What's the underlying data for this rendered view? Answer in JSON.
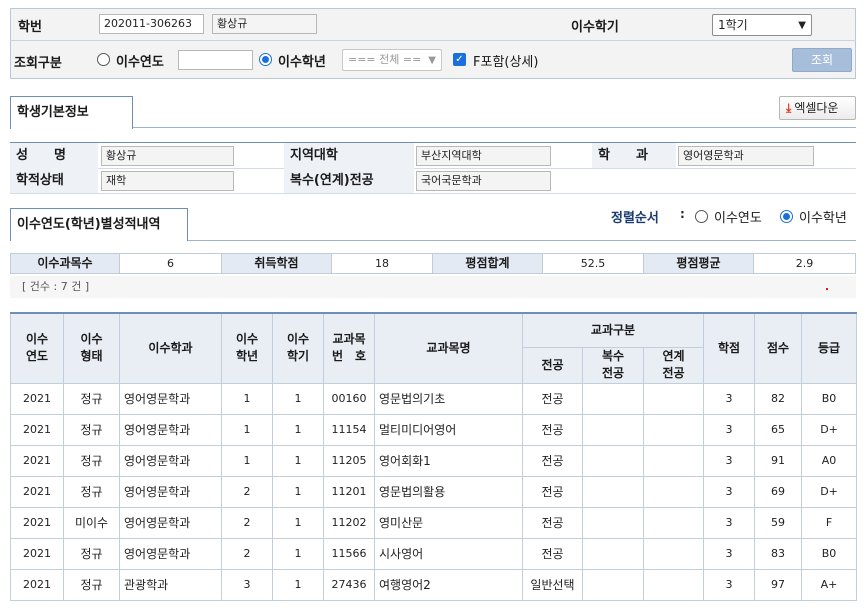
{
  "search": {
    "student_id_label": "학번",
    "student_id": "202011-306263",
    "student_name": "황상규",
    "semester_label": "이수학기",
    "semester_value": "1학기",
    "query_type_label": "조회구분",
    "opt_year_label": "이수연도",
    "opt_year_value": "",
    "opt_grade_label": "이수학년",
    "grade_select_value": "=== 전체 ==",
    "f_include_label": "F포함(상세)",
    "search_button": "조회"
  },
  "tabs": {
    "basic_info": "학생기본정보",
    "records": "이수연도(학년)별성적내역"
  },
  "excel_button": "엑셀다운",
  "info": {
    "name_label": "성　　명",
    "name": "황상규",
    "region_label": "지역대학",
    "region": "부산지역대학",
    "dept_label": "학　　과",
    "dept": "영어영문학과",
    "status_label": "학적상태",
    "status": "재학",
    "double_major_label": "복수(연계)전공",
    "double_major": "국어국문학과"
  },
  "sort": {
    "label": "정렬순서",
    "colon": ":",
    "opt_year": "이수연도",
    "opt_grade": "이수학년"
  },
  "summary": {
    "course_count_label": "이수과목수",
    "course_count": "6",
    "credits_label": "취득학점",
    "credits": "18",
    "grade_sum_label": "평점합계",
    "grade_sum": "52.5",
    "gpa_label": "평점평균",
    "gpa": "2.9"
  },
  "count_text": "[ 건수 : 7 건 ]",
  "table": {
    "headers": {
      "year": "이수\n연도",
      "type": "이수\n형태",
      "dept": "이수학과",
      "grade": "이수\n학년",
      "semester": "이수\n학기",
      "course_no": "교과목\n번　호",
      "course_name": "교과목명",
      "category": "교과구분",
      "major": "전공",
      "double": "복수\n전공",
      "linked": "연계\n전공",
      "credit": "학점",
      "score": "점수",
      "rank": "등급"
    },
    "rows": [
      {
        "year": "2021",
        "type": "정규",
        "dept": "영어영문학과",
        "grade": "1",
        "semester": "1",
        "no": "00160",
        "name": "영문법의기초",
        "major": "전공",
        "double": "",
        "linked": "",
        "credit": "3",
        "score": "82",
        "rank": "B0"
      },
      {
        "year": "2021",
        "type": "정규",
        "dept": "영어영문학과",
        "grade": "1",
        "semester": "1",
        "no": "11154",
        "name": "멀티미디어영어",
        "major": "전공",
        "double": "",
        "linked": "",
        "credit": "3",
        "score": "65",
        "rank": "D+"
      },
      {
        "year": "2021",
        "type": "정규",
        "dept": "영어영문학과",
        "grade": "1",
        "semester": "1",
        "no": "11205",
        "name": "영어회화1",
        "major": "전공",
        "double": "",
        "linked": "",
        "credit": "3",
        "score": "91",
        "rank": "A0"
      },
      {
        "year": "2021",
        "type": "정규",
        "dept": "영어영문학과",
        "grade": "2",
        "semester": "1",
        "no": "11201",
        "name": "영문법의활용",
        "major": "전공",
        "double": "",
        "linked": "",
        "credit": "3",
        "score": "69",
        "rank": "D+"
      },
      {
        "year": "2021",
        "type": "미이수",
        "dept": "영어영문학과",
        "grade": "2",
        "semester": "1",
        "no": "11202",
        "name": "영미산문",
        "major": "전공",
        "double": "",
        "linked": "",
        "credit": "3",
        "score": "59",
        "rank": "F"
      },
      {
        "year": "2021",
        "type": "정규",
        "dept": "영어영문학과",
        "grade": "2",
        "semester": "1",
        "no": "11566",
        "name": "시사영어",
        "major": "전공",
        "double": "",
        "linked": "",
        "credit": "3",
        "score": "83",
        "rank": "B0"
      },
      {
        "year": "2021",
        "type": "정규",
        "dept": "관광학과",
        "grade": "3",
        "semester": "1",
        "no": "27436",
        "name": "여행영어2",
        "major": "일반선택",
        "double": "",
        "linked": "",
        "credit": "3",
        "score": "97",
        "rank": "A+"
      }
    ]
  }
}
